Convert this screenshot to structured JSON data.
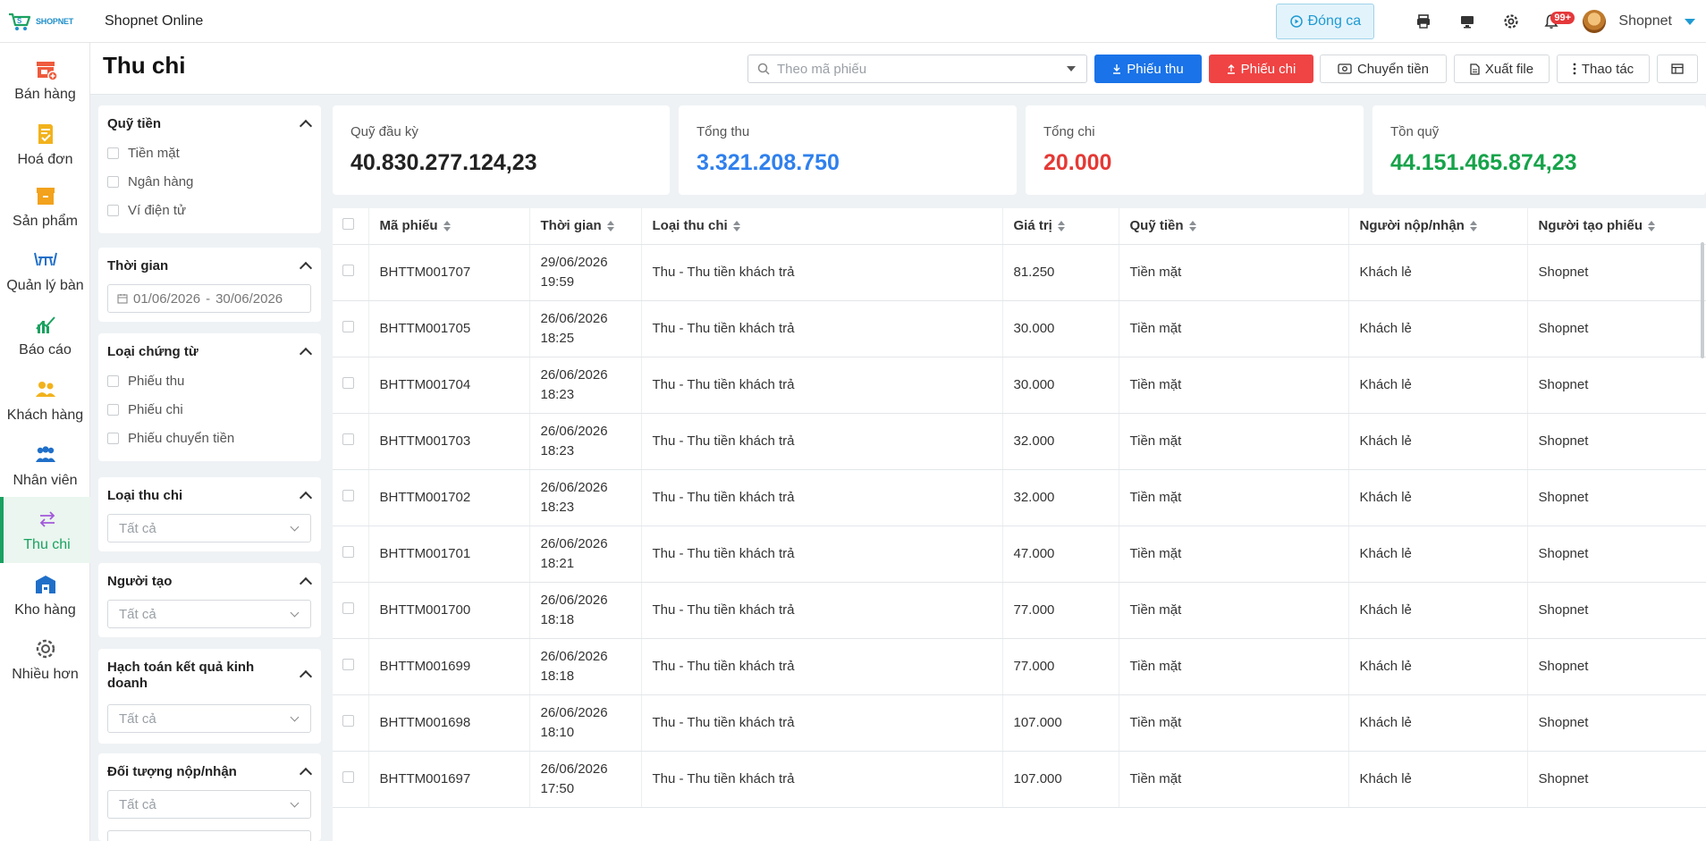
{
  "app": {
    "logo_text": "SHOPNET",
    "title": "Shopnet Online",
    "dong_ca_label": "Đóng ca",
    "notification_badge": "99+",
    "user_name": "Shopnet"
  },
  "sidebar": {
    "items": [
      {
        "label": "Bán hàng",
        "icon": "store-add-icon"
      },
      {
        "label": "Hoá đơn",
        "icon": "invoice-check-icon"
      },
      {
        "label": "Sản phẩm",
        "icon": "product-box-icon"
      },
      {
        "label": "Quản lý bàn",
        "icon": "table-icon"
      },
      {
        "label": "Báo cáo",
        "icon": "chart-up-icon"
      },
      {
        "label": "Khách hàng",
        "icon": "customers-icon"
      },
      {
        "label": "Nhân viên",
        "icon": "staff-icon"
      },
      {
        "label": "Thu chi",
        "icon": "transfer-arrows-icon",
        "active": true
      },
      {
        "label": "Kho hàng",
        "icon": "warehouse-icon"
      },
      {
        "label": "Nhiều hơn",
        "icon": "gear-icon"
      }
    ],
    "active_color": "#1aa160"
  },
  "page": {
    "title": "Thu chi",
    "search_placeholder": "Theo mã phiếu",
    "buttons": {
      "phieu_thu": "Phiếu thu",
      "phieu_chi": "Phiếu chi",
      "chuyen_tien": "Chuyển tiền",
      "xuat_file": "Xuất file",
      "thao_tac": "Thao tác"
    }
  },
  "filters": {
    "quy_tien": {
      "title": "Quỹ tiền",
      "options": [
        "Tiền mặt",
        "Ngân hàng",
        "Ví điện tử"
      ]
    },
    "thoi_gian": {
      "title": "Thời gian",
      "from": "01/06/2026",
      "separator": "-",
      "to": "30/06/2026"
    },
    "loai_chung_tu": {
      "title": "Loại chứng từ",
      "options": [
        "Phiếu thu",
        "Phiếu chi",
        "Phiếu chuyển tiền"
      ]
    },
    "loai_thu_chi": {
      "title": "Loại thu chi",
      "value": "Tất cả"
    },
    "nguoi_tao": {
      "title": "Người tạo",
      "value": "Tất cả"
    },
    "hach_toan": {
      "title": "Hạch toán kết quả kinh doanh",
      "value": "Tất cả"
    },
    "doi_tuong": {
      "title": "Đối tượng nộp/nhận",
      "value": "Tất cả"
    }
  },
  "stats": [
    {
      "label": "Quỹ đầu kỳ",
      "value": "40.830.277.124,23",
      "color": "#222222"
    },
    {
      "label": "Tổng thu",
      "value": "3.321.208.750",
      "color": "#2f80ed"
    },
    {
      "label": "Tổng chi",
      "value": "20.000",
      "color": "#e53935"
    },
    {
      "label": "Tồn quỹ",
      "value": "44.151.465.874,23",
      "color": "#16a34a"
    }
  ],
  "table": {
    "headers": [
      "Mã phiếu",
      "Thời gian",
      "Loại thu chi",
      "Giá trị",
      "Quỹ tiền",
      "Người nộp/nhận",
      "Người tạo phiếu"
    ],
    "rows": [
      {
        "ma": "BHTTM001707",
        "date": "29/06/2026",
        "time": "19:59",
        "loai": "Thu - Thu tiền khách trả",
        "gia_tri": "81.250",
        "quy": "Tiền mặt",
        "nguoi_nop": "Khách lẻ",
        "nguoi_tao": "Shopnet"
      },
      {
        "ma": "BHTTM001705",
        "date": "26/06/2026",
        "time": "18:25",
        "loai": "Thu - Thu tiền khách trả",
        "gia_tri": "30.000",
        "quy": "Tiền mặt",
        "nguoi_nop": "Khách lẻ",
        "nguoi_tao": "Shopnet"
      },
      {
        "ma": "BHTTM001704",
        "date": "26/06/2026",
        "time": "18:23",
        "loai": "Thu - Thu tiền khách trả",
        "gia_tri": "30.000",
        "quy": "Tiền mặt",
        "nguoi_nop": "Khách lẻ",
        "nguoi_tao": "Shopnet"
      },
      {
        "ma": "BHTTM001703",
        "date": "26/06/2026",
        "time": "18:23",
        "loai": "Thu - Thu tiền khách trả",
        "gia_tri": "32.000",
        "quy": "Tiền mặt",
        "nguoi_nop": "Khách lẻ",
        "nguoi_tao": "Shopnet"
      },
      {
        "ma": "BHTTM001702",
        "date": "26/06/2026",
        "time": "18:23",
        "loai": "Thu - Thu tiền khách trả",
        "gia_tri": "32.000",
        "quy": "Tiền mặt",
        "nguoi_nop": "Khách lẻ",
        "nguoi_tao": "Shopnet"
      },
      {
        "ma": "BHTTM001701",
        "date": "26/06/2026",
        "time": "18:21",
        "loai": "Thu - Thu tiền khách trả",
        "gia_tri": "47.000",
        "quy": "Tiền mặt",
        "nguoi_nop": "Khách lẻ",
        "nguoi_tao": "Shopnet"
      },
      {
        "ma": "BHTTM001700",
        "date": "26/06/2026",
        "time": "18:18",
        "loai": "Thu - Thu tiền khách trả",
        "gia_tri": "77.000",
        "quy": "Tiền mặt",
        "nguoi_nop": "Khách lẻ",
        "nguoi_tao": "Shopnet"
      },
      {
        "ma": "BHTTM001699",
        "date": "26/06/2026",
        "time": "18:18",
        "loai": "Thu - Thu tiền khách trả",
        "gia_tri": "77.000",
        "quy": "Tiền mặt",
        "nguoi_nop": "Khách lẻ",
        "nguoi_tao": "Shopnet"
      },
      {
        "ma": "BHTTM001698",
        "date": "26/06/2026",
        "time": "18:10",
        "loai": "Thu - Thu tiền khách trả",
        "gia_tri": "107.000",
        "quy": "Tiền mặt",
        "nguoi_nop": "Khách lẻ",
        "nguoi_tao": "Shopnet"
      },
      {
        "ma": "BHTTM001697",
        "date": "26/06/2026",
        "time": "17:50",
        "loai": "Thu - Thu tiền khách trả",
        "gia_tri": "107.000",
        "quy": "Tiền mặt",
        "nguoi_nop": "Khách lẻ",
        "nguoi_tao": "Shopnet"
      }
    ]
  }
}
